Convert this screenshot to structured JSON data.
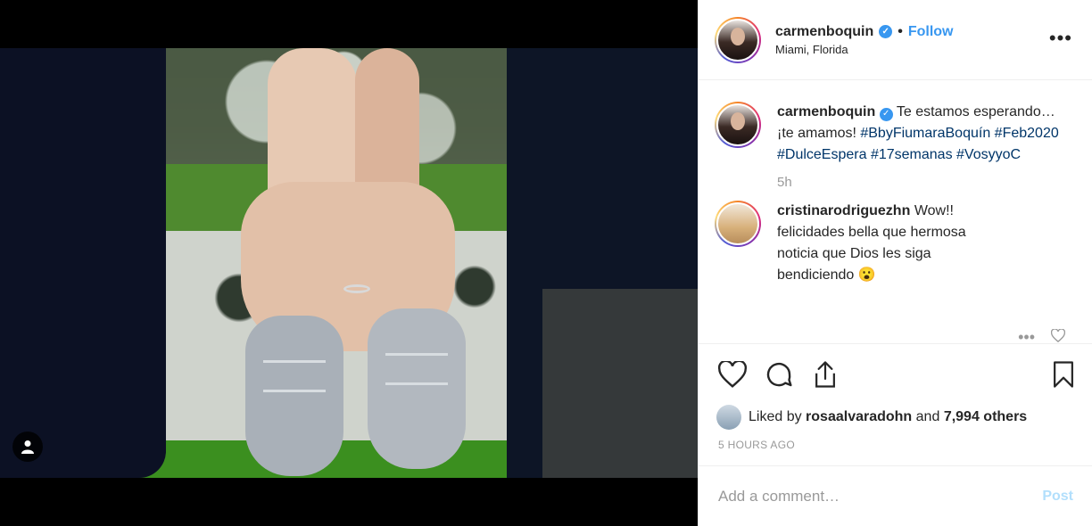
{
  "post": {
    "username": "carmenboquin",
    "location": "Miami, Florida",
    "follow_label": "Follow",
    "more_label": "•••"
  },
  "caption": {
    "username": "carmenboquin",
    "text": "Te estamos esperando… ¡te amamos! ",
    "tags": [
      "#BbyFiumaraBoquín",
      "#Feb2020",
      "#DulceEspera",
      "#17semanas",
      "#VosyyoC"
    ],
    "time": "5h"
  },
  "reply": {
    "username": "cristinarodriguezhn",
    "text": "Wow!! felicidades bella que hermosa noticia que Dios les siga bendiciendo 😮",
    "more_label": "•••"
  },
  "likes": {
    "prefix": "Liked by",
    "user": "rosaalvaradohn",
    "connector": "and",
    "others": "7,994 others"
  },
  "timestamp": "5 HOURS AGO",
  "add_comment": {
    "placeholder": "Add a comment…",
    "post_label": "Post"
  },
  "icons": [
    "user-tag-icon",
    "verified-icon",
    "more-options-icon",
    "heart-icon",
    "comment-icon",
    "share-icon",
    "bookmark-icon"
  ],
  "colors": {
    "link": "#3897f0",
    "hashtag": "#003569",
    "muted": "#999999",
    "post_disabled": "#b2dffc"
  }
}
